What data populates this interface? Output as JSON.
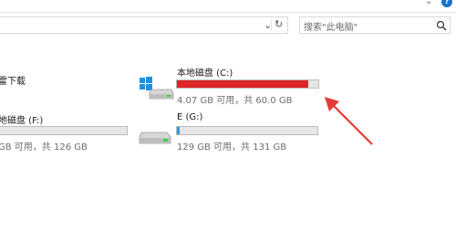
{
  "address_bar": {
    "dropdown_icon": "chevron-down-icon",
    "refresh_icon": "refresh-icon"
  },
  "search": {
    "placeholder": "搜索\"此电脑\"",
    "icon": "search-icon"
  },
  "drives": [
    {
      "label": "雷下载",
      "info": ""
    },
    {
      "label": "本地磁盘 (C:)",
      "info": "4.07 GB 可用，共 60.0 GB",
      "used_fraction": 0.93,
      "bar_color": "#da2626"
    },
    {
      "label": "地磁盘 (F:)",
      "info": "GB 可用，共 126 GB",
      "used_fraction": 0.0,
      "bar_color": "#26a0da"
    },
    {
      "label": "E (G:)",
      "info": "129 GB 可用，共 131 GB",
      "used_fraction": 0.02,
      "bar_color": "#26a0da"
    }
  ],
  "colors": {
    "critical": "#da2626",
    "normal": "#26a0da",
    "arrow": "#e53935"
  }
}
